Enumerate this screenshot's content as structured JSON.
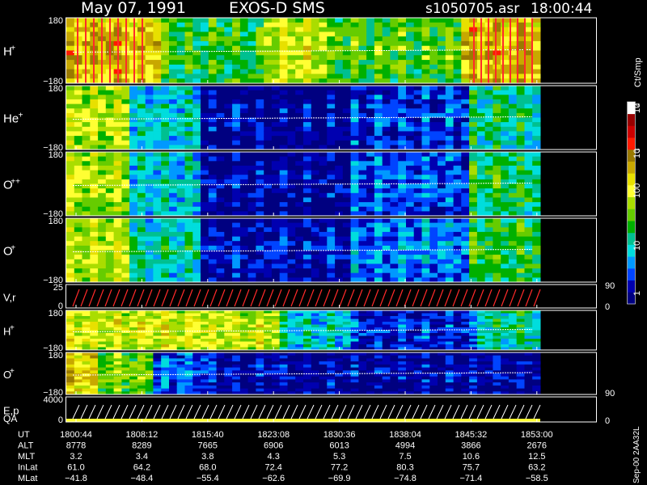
{
  "header": {
    "date": "May 07, 1991",
    "instrument": "EXOS-D SMS",
    "file": "s1050705.asr",
    "time": "18:00:44"
  },
  "colors": {
    "background": "#000000",
    "text": "#ffffff",
    "trace_red": "#ff2a2a",
    "accent_yellow": "#ffff33"
  },
  "colorbar": {
    "unit_label": "Ct/Smp",
    "tick_labels": [
      "1",
      "10",
      "100",
      "10",
      "3",
      "10",
      "4"
    ],
    "levels": [
      "#000080",
      "#0000b0",
      "#0044ff",
      "#0099ff",
      "#00dddd",
      "#00c090",
      "#00b000",
      "#66cc00",
      "#aadd00",
      "#ffff33",
      "#e8e000",
      "#c8a800",
      "#9a7a00",
      "#ff1a00",
      "#cc0000",
      "#990000",
      "#ffffff"
    ]
  },
  "panels": [
    {
      "label": "H",
      "sup": "+",
      "ymax": "180",
      "ymin": "−180"
    },
    {
      "label": "He",
      "sup": "+",
      "ymax": "180",
      "ymin": "−180"
    },
    {
      "label": "O",
      "sup": "++",
      "ymax": "180",
      "ymin": "−180"
    },
    {
      "label": "O",
      "sup": "+",
      "ymax": "180",
      "ymin": "−180"
    },
    {
      "label": "V,r",
      "sup": "",
      "ymax": "25",
      "ymin": "0",
      "right_top": "90",
      "right_bottom": "0"
    },
    {
      "label": "H",
      "sup": "+",
      "ymax": "180",
      "ymin": "−180"
    },
    {
      "label": "O",
      "sup": "+",
      "ymax": "180",
      "ymin": "−180",
      "right_bottom": "90"
    },
    {
      "label": "E,p",
      "sup": "",
      "ymax": "4000",
      "ymin": "0",
      "right_bottom": "0"
    }
  ],
  "qa_label": "QA",
  "footer_stamp": "Sep-00 2AA32L",
  "chart_data": {
    "type": "heatmap",
    "title": "May 07, 1991   EXOS-D SMS",
    "xlabel": "UT",
    "row_labels": [
      "UT",
      "ALT",
      "MLT",
      "InLat",
      "MLat"
    ],
    "ticks": [
      {
        "UT": "1800:44",
        "ALT": "8778",
        "MLT": "3.2",
        "InLat": "61.0",
        "MLat": "−41.8"
      },
      {
        "UT": "1808:12",
        "ALT": "8289",
        "MLT": "3.4",
        "InLat": "64.2",
        "MLat": "−48.4"
      },
      {
        "UT": "1815:40",
        "ALT": "7665",
        "MLT": "3.8",
        "InLat": "68.0",
        "MLat": "−55.4"
      },
      {
        "UT": "1823:08",
        "ALT": "6906",
        "MLT": "4.3",
        "InLat": "72.4",
        "MLat": "−62.6"
      },
      {
        "UT": "1830:36",
        "ALT": "6013",
        "MLT": "5.3",
        "InLat": "77.2",
        "MLat": "−69.9"
      },
      {
        "UT": "1838:04",
        "ALT": "4994",
        "MLT": "7.5",
        "InLat": "80.3",
        "MLat": "−74.8"
      },
      {
        "UT": "1845:32",
        "ALT": "3866",
        "MLT": "10.6",
        "InLat": "75.7",
        "MLat": "−71.4"
      },
      {
        "UT": "1853:00",
        "ALT": "2676",
        "MLT": "12.5",
        "InLat": "63.2",
        "MLat": "−58.5"
      }
    ]
  }
}
